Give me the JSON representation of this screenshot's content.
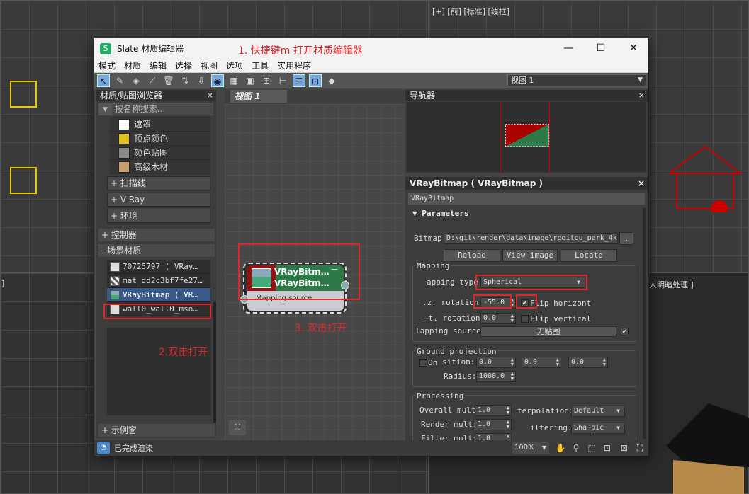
{
  "viewport_labels": {
    "top_right": "[+] [前] [标准] [线框]",
    "right_mid": "人明暗处理 ]",
    "left_mid": "]"
  },
  "window": {
    "title": "Slate 材质编辑器",
    "annotation1": "1. 快捷键m 打开材质编辑器",
    "min_icon": "—",
    "max_icon": "☐",
    "close_icon": "✕"
  },
  "menu": [
    "模式",
    "材质",
    "编辑",
    "选择",
    "视图",
    "选项",
    "工具",
    "实用程序"
  ],
  "view_select": "视图 1",
  "browser": {
    "title": "材质/贴图浏览器",
    "search_placeholder": "按名称搜索...",
    "maps": [
      {
        "label": "遮罩",
        "color": "#ffffff"
      },
      {
        "label": "顶点颜色",
        "color": "#e0c020"
      },
      {
        "label": "颜色贴图",
        "color": "#8a8a8a"
      },
      {
        "label": "高级木材",
        "color": "#c8a070"
      }
    ],
    "groups": [
      "+ 扫描线",
      "+ V-Ray",
      "+ 环境"
    ],
    "controllers": "+ 控制器",
    "scene_materials": "- 场景材质",
    "materials": [
      "70725797  ( VRay…",
      "mat_dd2c3bf7fe27…",
      "VRayBitmap  ( VR…",
      "wall0_wall0_mso…"
    ],
    "samples": "+ 示例窗"
  },
  "annotation2": "2.双击打开",
  "annotation3": "3. 双击打开",
  "view_tab": "视图 1",
  "node": {
    "title1": "VRayBitm…",
    "title2": "VRayBitm…",
    "minus": "—",
    "output": "Mapping source"
  },
  "navigator_title": "导航器",
  "props": {
    "header": "VRayBitmap ( VRayBitmap )",
    "name": "VRayBitmap",
    "rollout": "Parameters",
    "bitmap_label": "Bitmap:",
    "bitmap_path": "D:\\git\\render\\data\\image\\rooitou_park_4k",
    "browse": "...",
    "reload": "Reload",
    "view_image": "View image",
    "locate": "Locate",
    "mapping_group": "Mapping",
    "mapping_type_label": "apping type",
    "mapping_type": "Spherical",
    "hz_rotation_label": ".z. rotation:",
    "hz_rotation": "-55.0",
    "flip_horizontal": "Flip horizont",
    "vt_rotation_label": "~t. rotation:",
    "vt_rotation": "0.0",
    "flip_vertical": "Flip vertical",
    "mapping_source_label": "lapping source:",
    "mapping_source": "无贴图",
    "ground_group": "Ground projection",
    "on_label": "On",
    "position_label": "sition:",
    "pos_x": "0.0",
    "pos_y": "0.0",
    "pos_z": "0.0",
    "radius_label": "Radius:",
    "radius": "1000.0",
    "processing_group": "Processing",
    "overall_mult_label": "Overall mult:",
    "overall_mult": "1.0",
    "render_mult_label": "Render mult:",
    "render_mult": "1.0",
    "filter_mult_label": "Filter mult:",
    "filter_mult": "1.0",
    "interp_label": "terpolation:",
    "interp": "Default",
    "filtering_label": "iltering:",
    "filtering": "Sha~pic"
  },
  "status": {
    "text": "已完成渲染",
    "zoom": "100%"
  },
  "colors": {
    "annotation_red": "#e0262a",
    "node_green": "#2d7a48",
    "node_red": "#9a1010"
  }
}
